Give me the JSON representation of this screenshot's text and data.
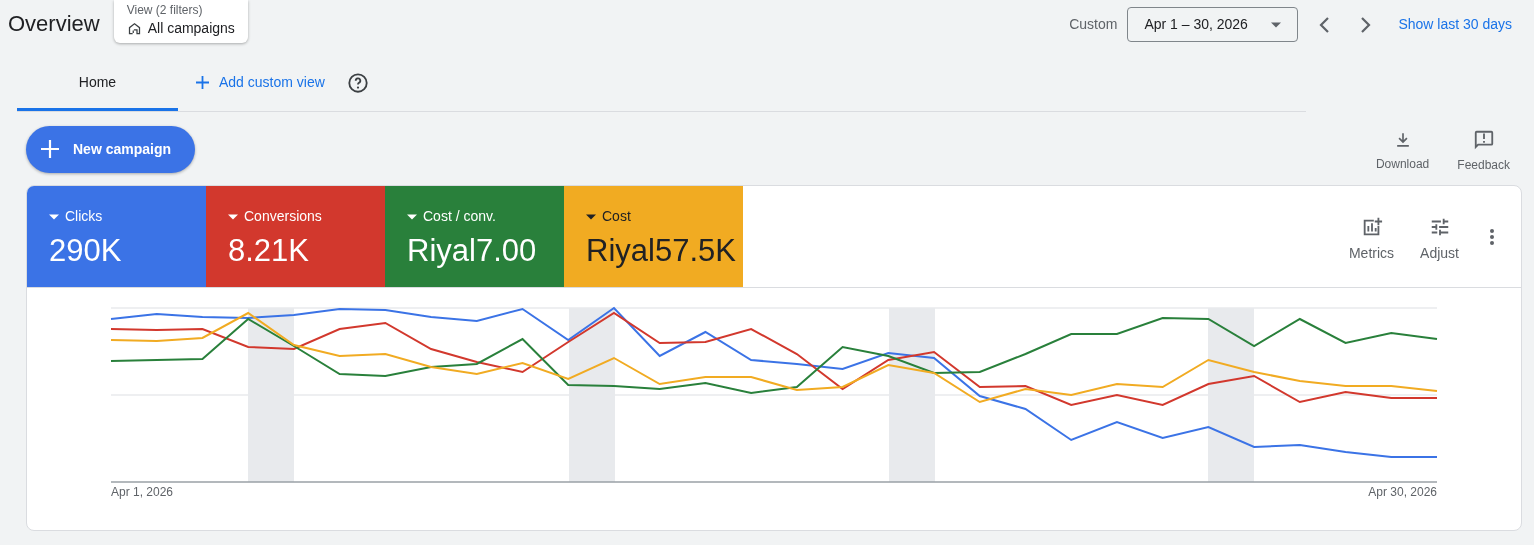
{
  "header": {
    "title": "Overview",
    "filter_label": "View (2 filters)",
    "filter_value": "All campaigns",
    "range_label": "Custom",
    "date_range": "Apr 1 – 30, 2026",
    "show_last": "Show last 30 days"
  },
  "tabs": [
    {
      "label": "Home",
      "selected": true
    }
  ],
  "add_view": "Add custom view",
  "new_campaign": "New campaign",
  "actions": [
    {
      "kind": "download",
      "label": "Download"
    },
    {
      "kind": "feedback",
      "label": "Feedback"
    }
  ],
  "metrics": [
    {
      "label": "Clicks",
      "value": "290K",
      "color": "#3b73e6"
    },
    {
      "label": "Conversions",
      "value": "8.21K",
      "color": "#d2382d"
    },
    {
      "label": "Cost / conv.",
      "value": "Riyal7.00",
      "color": "#29803b"
    },
    {
      "label": "Cost",
      "value": "Riyal57.5K",
      "color": "#f1ab22"
    }
  ],
  "chart_tools": [
    {
      "kind": "metrics",
      "label": "Metrics"
    },
    {
      "kind": "adjust",
      "label": "Adjust"
    }
  ],
  "chart": {
    "x_start": "Apr 1, 2026",
    "x_end": "Apr 30, 2026"
  }
}
